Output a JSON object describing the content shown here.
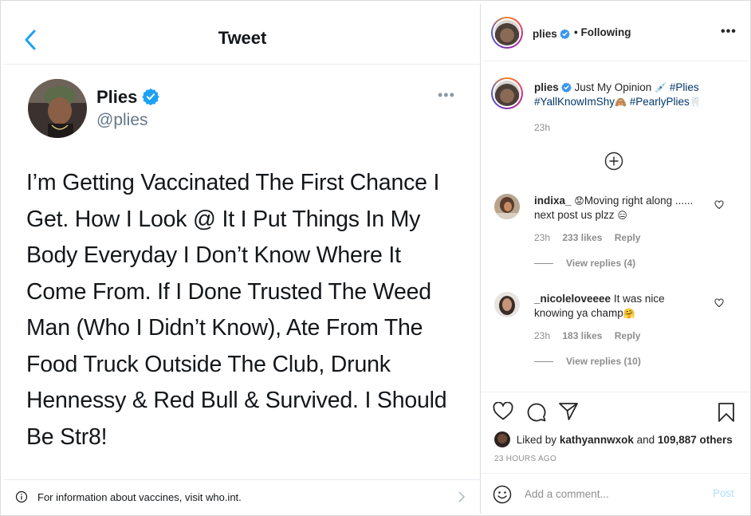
{
  "tweet": {
    "header_title": "Tweet",
    "name": "Plies",
    "handle": "@plies",
    "text": "I’m Getting Vaccinated The First Chance I Get. How I Look @ It I Put Things In My Body Everyday I Don’t Know Where It Come From. If I Done Trusted The Weed Man (Who I Didn’t Know), Ate From The Food Truck Outside The Club, Drunk Hennessy & Red Bull & Survived. I Should Be Str8!",
    "more": "•••",
    "info_text": "For information about vaccines, visit who.int."
  },
  "post": {
    "username": "plies",
    "following": "• Following",
    "more": "•••",
    "caption_text": "Just My Opinion",
    "caption_emoji1": "💉",
    "hashtag1": "#Plies",
    "hashtag2": "#YallKnowImShy",
    "caption_emoji2": "🙈",
    "hashtag3": "#PearlyPlies",
    "caption_emoji3": "🦷",
    "caption_time": "23h",
    "likes_prefix": "Liked by",
    "likes_user": "kathyannwxok",
    "likes_and": "and",
    "likes_count": "109,887 others",
    "age": "23 HOURS AGO"
  },
  "comments": [
    {
      "user": "indixa_",
      "text_emoji": "😟",
      "text": "Moving right along ...... next post us plzz",
      "text_emoji2": "😑",
      "time": "23h",
      "likes": "233 likes",
      "reply": "Reply",
      "view_replies": "View replies (4)"
    },
    {
      "user": "_nicoleloveeee",
      "text": "It was nice knowing ya champ",
      "text_emoji": "🤗",
      "time": "23h",
      "likes": "183 likes",
      "reply": "Reply",
      "view_replies": "View replies (10)"
    }
  ],
  "comment_box": {
    "placeholder": "Add a comment...",
    "post_label": "Post"
  },
  "colors": {
    "twitter_blue": "#1da1f2",
    "ig_link": "#00376b",
    "post_disabled": "#b2dffc"
  },
  "icons": [
    "back-arrow-icon",
    "verified-badge-icon",
    "info-icon",
    "chevron-right-icon",
    "plus-circle-icon",
    "heart-icon",
    "comment-icon",
    "share-icon",
    "bookmark-icon",
    "emoji-icon"
  ]
}
